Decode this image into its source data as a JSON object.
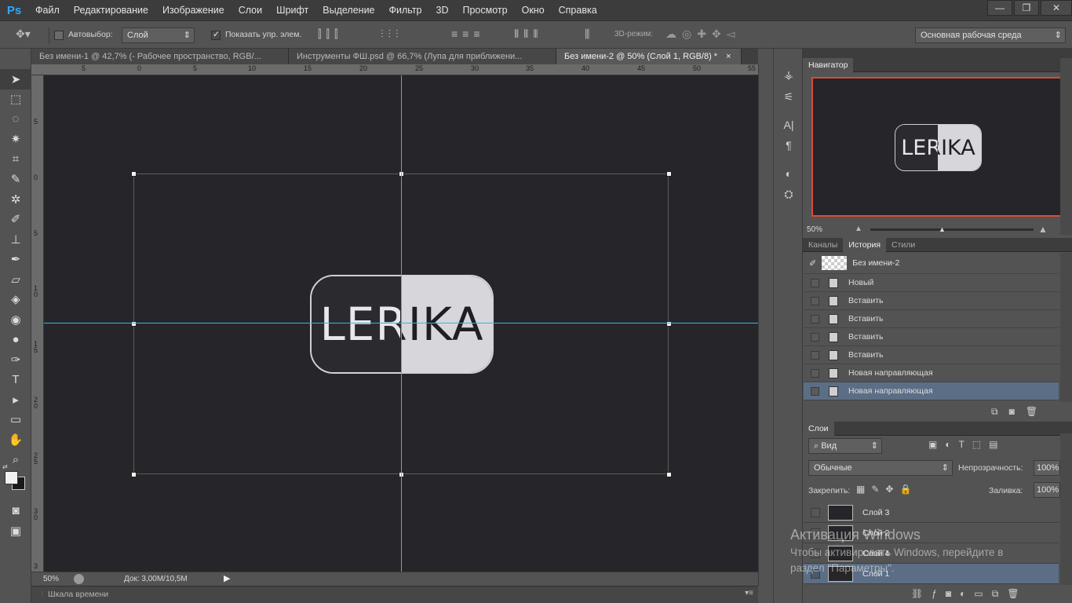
{
  "app": {
    "logo": "Ps",
    "menu": [
      "Файл",
      "Редактирование",
      "Изображение",
      "Слои",
      "Шрифт",
      "Выделение",
      "Фильтр",
      "3D",
      "Просмотр",
      "Окно",
      "Справка"
    ],
    "window_controls": {
      "minimize": "—",
      "restore": "❐",
      "close": "✕"
    }
  },
  "options_bar": {
    "autoselect_label": "Автовыбор:",
    "autoselect_value": "Слой",
    "show_controls_label": "Показать упр. элем.",
    "mode_3d_label": "3D-режим:",
    "workspace": "Основная рабочая среда"
  },
  "tabs": [
    {
      "label": "Без имени-1 @ 42,7% (- Рабочее пространство, RGB/..."
    },
    {
      "label": "Инструменты ФШ.psd @ 66,7% (Лупа для приближени..."
    },
    {
      "label": "Без имени-2 @ 50% (Слой 1, RGB/8) *",
      "close": "×"
    }
  ],
  "rulers": {
    "top": [
      "5",
      "0",
      "5",
      "10",
      "15",
      "20",
      "25",
      "30",
      "35",
      "40",
      "45",
      "50",
      "55"
    ],
    "left": [
      "5",
      "0",
      "5",
      "1 0",
      "1 5",
      "2 0",
      "2 5",
      "3 0",
      "3"
    ]
  },
  "canvas": {
    "logo_text": "LERIKA",
    "guide_color": "#38b6e8"
  },
  "status": {
    "zoom": "50%",
    "doc": "Док: 3,00M/10,5M",
    "timeline": "Шкала времени"
  },
  "navigator": {
    "title": "Навигатор",
    "zoom": "50%",
    "logo_text": "LERIKA",
    "frame_color": "#d84b3a"
  },
  "history": {
    "tabs": [
      "Каналы",
      "История",
      "Стили"
    ],
    "snapshot": "Без имени-2",
    "items": [
      "Новый",
      "Вставить",
      "Вставить",
      "Вставить",
      "Вставить",
      "Новая направляющая",
      "Новая направляющая"
    ]
  },
  "layers": {
    "title": "Слои",
    "filter": "Вид",
    "blend_mode": "Обычные",
    "opacity_label": "Непрозрачность:",
    "opacity_value": "100%",
    "lock_label": "Закрепить:",
    "fill_label": "Заливка:",
    "fill_value": "100%",
    "items": [
      "Слой 3",
      "Слой 2",
      "Слой 4",
      "Слой 1"
    ]
  },
  "watermark": {
    "title": "Активация Windows",
    "line1": "Чтобы активировать Windows, перейдите в",
    "line2": "раздел \"Параметры\"."
  }
}
